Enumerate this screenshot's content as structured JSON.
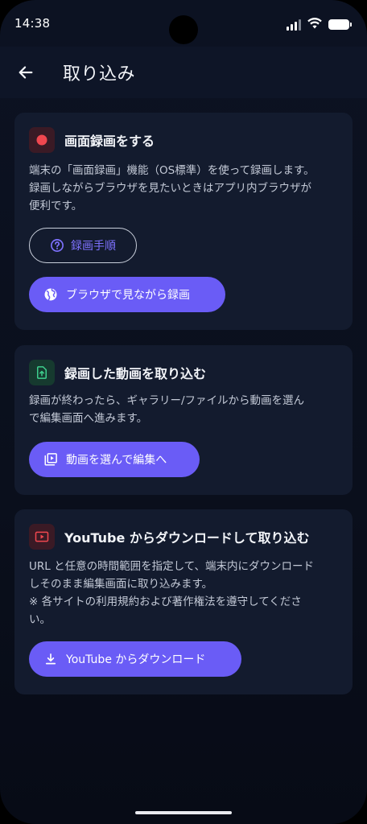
{
  "status": {
    "time": "14:38",
    "icons": [
      "signal-icon",
      "wifi-icon",
      "battery-icon"
    ]
  },
  "appbar": {
    "title": "取り込み",
    "back_icon": "arrow-left-icon"
  },
  "cards": [
    {
      "icon": "record-dot-icon",
      "title": "画面録画をする",
      "description": [
        "端末の「画面録画」機能（OS標準）を使って録画します。",
        "録画しながらブラウザを見たいときはアプリ内ブラウザが",
        "便利です。"
      ],
      "outline_button": {
        "label": "録画手順",
        "icon": "help-circle-icon"
      },
      "filled_button": {
        "label": "ブラウザで見ながら録画",
        "icon": "globe-icon"
      }
    },
    {
      "icon": "file-upload-icon",
      "title": "録画した動画を取り込む",
      "description": [
        "録画が終わったら、ギャラリー/ファイルから動画を選ん",
        "で編集画面へ進みます。"
      ],
      "filled_button": {
        "label": "動画を選んで編集へ",
        "icon": "video-library-icon"
      }
    },
    {
      "icon": "youtube-play-icon",
      "title": "YouTube からダウンロードして取り込む",
      "description": [
        "URL と任意の時間範囲を指定して、端末内にダウンロード",
        "しそのまま編集画面に取り込みます。",
        "※ 各サイトの利用規約および著作権法を遵守してくださ",
        "い。"
      ],
      "filled_button": {
        "label": "YouTube からダウンロード",
        "icon": "download-icon"
      }
    }
  ],
  "colors": {
    "background": "#0a0f1c",
    "card": "#131b2e",
    "accent": "#6a5cf6",
    "accent_text": "#7e72ff",
    "record_red": "#f0474f",
    "green": "#3ecf8e"
  }
}
